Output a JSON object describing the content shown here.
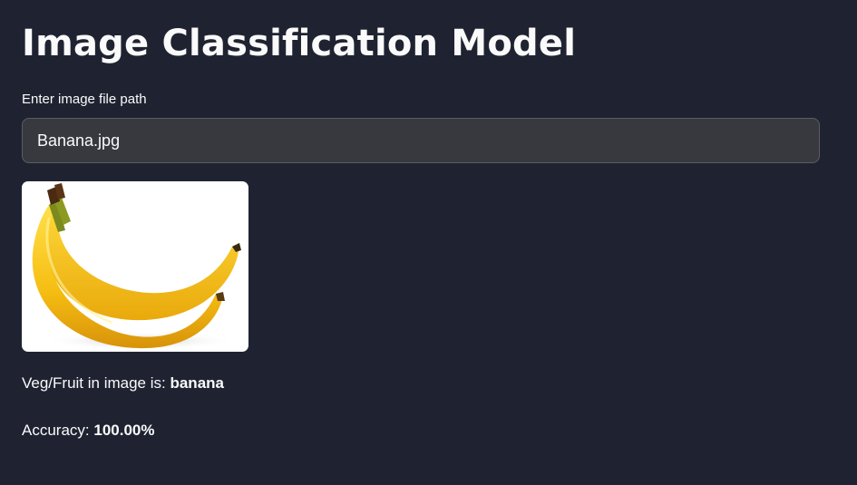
{
  "app": {
    "title": "Image Classification Model"
  },
  "input": {
    "label": "Enter image file path",
    "value": "Banana.jpg"
  },
  "image": {
    "alt": "Banana.jpg",
    "icon": "banana-image"
  },
  "results": {
    "prediction_prefix": "Veg/Fruit in image is: ",
    "prediction_value": "banana",
    "accuracy_prefix": "Accuracy: ",
    "accuracy_value": "100.00%"
  },
  "colors": {
    "background": "#1f2331",
    "input_background": "#37393f",
    "text": "#fafafa",
    "banana_yellow": "#f5c60f"
  }
}
